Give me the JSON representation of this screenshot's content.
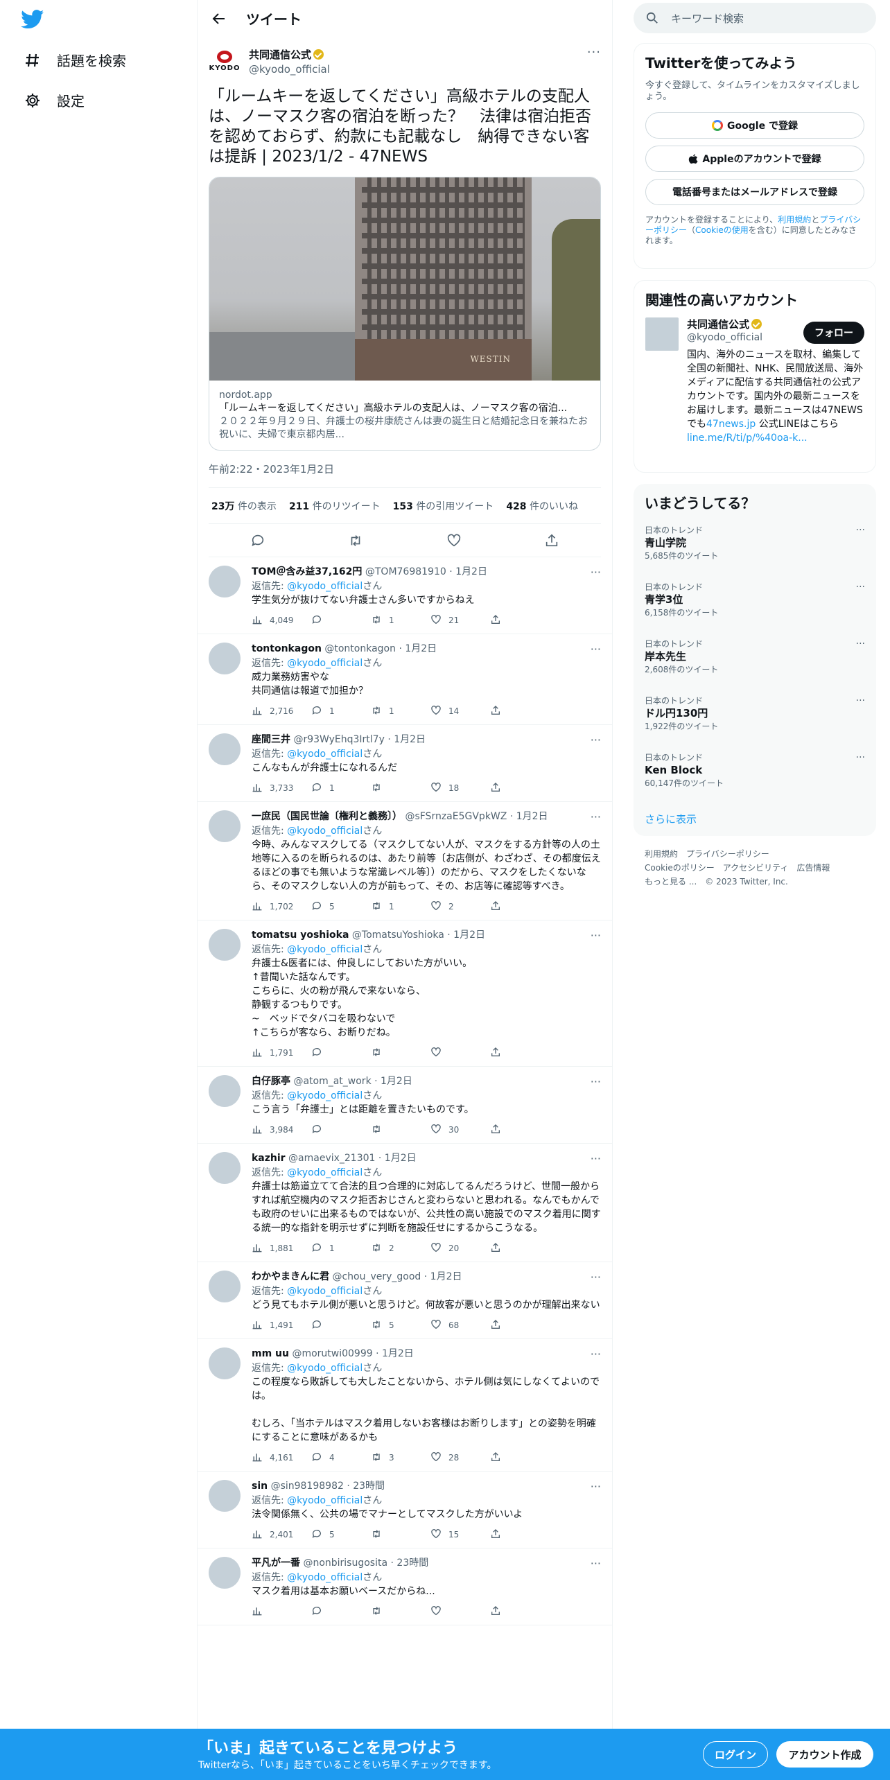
{
  "nav": {
    "explore": "話題を検索",
    "settings": "設定"
  },
  "header": {
    "title": "ツイート"
  },
  "tweet": {
    "author_name": "共同通信公式",
    "author_handle": "@kyodo_official",
    "logo_text": "KYODO",
    "text": "「ルームキーを返してください」高級ホテルの支配人は、ノーマスク客の宿泊を断った？　法律は宿泊拒否を認めておらず、約款にも記載なし　納得できない客は提訴 | 2023/1/2 - 47NEWS",
    "card_sign": "WESTIN",
    "card_site": "nordot.app",
    "card_title": "「ルームキーを返してください」高級ホテルの支配人は、ノーマスク客の宿泊...",
    "card_desc": "２０２２年９月２９日、弁護士の桜井康統さんは妻の誕生日と結婚記念日を兼ねたお祝いに、夫婦で東京都内居...",
    "date": "午前2:22・2023年1月2日",
    "views": "23万",
    "views_label": "件の表示",
    "retweets": "211",
    "retweets_label": "件のリツイート",
    "quotes": "153",
    "quotes_label": "件の引用ツイート",
    "likes": "428",
    "likes_label": "件のいいね"
  },
  "reply_to_label": "返信先: ",
  "reply_to_handle": "@kyodo_official",
  "reply_to_suffix": "さん",
  "replies": [
    {
      "name": "TOM＠含み益37,162円",
      "handle": "@TOM76981910",
      "time": "· 1月2日",
      "text": "学生気分が抜けてない弁護士さん多いですからねえ",
      "views": "4,049",
      "replies": "",
      "retweets": "1",
      "likes": "21"
    },
    {
      "name": "tontonkagon",
      "handle": "@tontonkagon",
      "time": "· 1月2日",
      "text": "威力業務妨害やな\n共同通信は報道で加担か？",
      "views": "2,716",
      "replies": "1",
      "retweets": "1",
      "likes": "14"
    },
    {
      "name": "座間三井",
      "handle": "@r93WyEhq3Irtl7y",
      "time": "· 1月2日",
      "text": "こんなもんが弁護士になれるんだ",
      "views": "3,733",
      "replies": "1",
      "retweets": "",
      "likes": "18"
    },
    {
      "name": "一庶民（国民世論〔権利と義務〕）",
      "handle": "@sFSrnzaE5GVpkWZ",
      "time": "· 1月2日",
      "text": "今時、みんなマスクしてる（マスクしてない人が、マスクをする方針等の人の土地等に入るのを断られるのは、あたり前等〔お店側が、わざわざ、その都度伝えるほどの事でも無いような常識レベル等〕）のだから、マスクをしたくないなら、そのマスクしない人の方が前もって、その、お店等に確認等すべき。",
      "views": "1,702",
      "replies": "5",
      "retweets": "1",
      "likes": "2"
    },
    {
      "name": "tomatsu yoshioka",
      "handle": "@TomatsuYoshioka",
      "time": "· 1月2日",
      "text": "弁護士&医者には、仲良しにしておいた方がいい。\n↑昔聞いた話なんです。\nこちらに、火の粉が飛んで来ないなら、\n静観するつもりです。\n~　ベッドでタバコを吸わないで\n↑こちらが客なら、お断りだね。",
      "views": "1,791",
      "replies": "",
      "retweets": "",
      "likes": ""
    },
    {
      "name": "白仔豚亭",
      "handle": "@atom_at_work",
      "time": "· 1月2日",
      "text": "こう言う「弁護士」とは距離を置きたいものです。",
      "views": "3,984",
      "replies": "",
      "retweets": "",
      "likes": "30"
    },
    {
      "name": "kazhir",
      "handle": "@amaevix_21301",
      "time": "· 1月2日",
      "text": "弁護士は筋道立てて合法的且つ合理的に対応してるんだろうけど、世間一般からすれば航空機内のマスク拒否おじさんと変わらないと思われる。なんでもかんでも政府のせいに出来るものではないが、公共性の高い施設でのマスク着用に関する統一的な指針を明示せずに判断を施設任せにするからこうなる。",
      "views": "1,881",
      "replies": "1",
      "retweets": "2",
      "likes": "20"
    },
    {
      "name": "わかやまきんに君",
      "handle": "@chou_very_good",
      "time": "· 1月2日",
      "text": "どう見てもホテル側が悪いと思うけど。何故客が悪いと思うのかが理解出来ない",
      "views": "1,491",
      "replies": "",
      "retweets": "5",
      "likes": "68"
    },
    {
      "name": "mm uu",
      "handle": "@morutwi00999",
      "time": "· 1月2日",
      "text": "この程度なら敗訴しても大したことないから、ホテル側は気にしなくてよいのでは。\n\nむしろ、「当ホテルはマスク着用しないお客様はお断りします」との姿勢を明確にすることに意味があるかも",
      "views": "4,161",
      "replies": "4",
      "retweets": "3",
      "likes": "28"
    },
    {
      "name": "sin",
      "handle": "@sin98198982",
      "time": "· 23時間",
      "text": "法令関係無く、公共の場でマナーとしてマスクした方がいいよ",
      "views": "2,401",
      "replies": "5",
      "retweets": "",
      "likes": "15"
    },
    {
      "name": "平凡が一番",
      "handle": "@nonbirisugosita",
      "time": "· 23時間",
      "text": "マスク着用は基本お願いベースだからね...",
      "views": "",
      "replies": "",
      "retweets": "",
      "likes": ""
    }
  ],
  "right": {
    "search_placeholder": "キーワード検索",
    "signup_title": "Twitterを使ってみよう",
    "signup_sub": "今すぐ登録して、タイムラインをカスタマイズしましょう。",
    "btn_google": "Google で登録",
    "btn_apple": "Appleのアカウントで登録",
    "btn_phone": "電話番号またはメールアドレスで登録",
    "legal_1": "アカウントを登録することにより、",
    "legal_terms": "利用規約",
    "legal_2": "と",
    "legal_privacy": "プライバシーポリシー",
    "legal_3": "（",
    "legal_cookie": "Cookieの使用",
    "legal_4": "を含む）に同意したとみなされます。",
    "related_title": "関連性の高いアカウント",
    "rel_name": "共同通信公式",
    "rel_handle": "@kyodo_official",
    "follow": "フォロー",
    "rel_bio": "国内、海外のニュースを取材、編集して全国の新聞社、NHK、民間放送局、海外メディアに配信する共同通信社の公式アカウントです。国内外の最新ニュースをお届けします。最新ニュースは47NEWSでも",
    "rel_link1": "47news.jp",
    "rel_bio2": " 公式LINEはこちら",
    "rel_link2": "line.me/R/ti/p/%40oa-k...",
    "trends_title": "いまどうしてる？",
    "trends": [
      {
        "cat": "日本のトレンド",
        "name": "青山学院",
        "count": "5,685件のツイート"
      },
      {
        "cat": "日本のトレンド",
        "name": "青学3位",
        "count": "6,158件のツイート"
      },
      {
        "cat": "日本のトレンド",
        "name": "岸本先生",
        "count": "2,608件のツイート"
      },
      {
        "cat": "日本のトレンド",
        "name": "ドル円130円",
        "count": "1,922件のツイート"
      },
      {
        "cat": "日本のトレンド",
        "name": "Ken Block",
        "count": "60,147件のツイート"
      }
    ],
    "show_more": "さらに表示",
    "footer_1": [
      "利用規約",
      "プライバシーポリシー"
    ],
    "footer_2": [
      "Cookieのポリシー",
      "アクセシビリティ",
      "広告情報"
    ],
    "footer_3": [
      "もっと見る ...",
      "© 2023 Twitter, Inc."
    ]
  },
  "bottom": {
    "headline": "「いま」起きていることを見つけよう",
    "sub": "Twitterなら、「いま」起きていることをいち早くチェックできます。",
    "login": "ログイン",
    "signup": "アカウント作成"
  },
  "colors": {
    "accent": "#1d9bf0",
    "text": "#0f1419",
    "muted": "#536471"
  }
}
